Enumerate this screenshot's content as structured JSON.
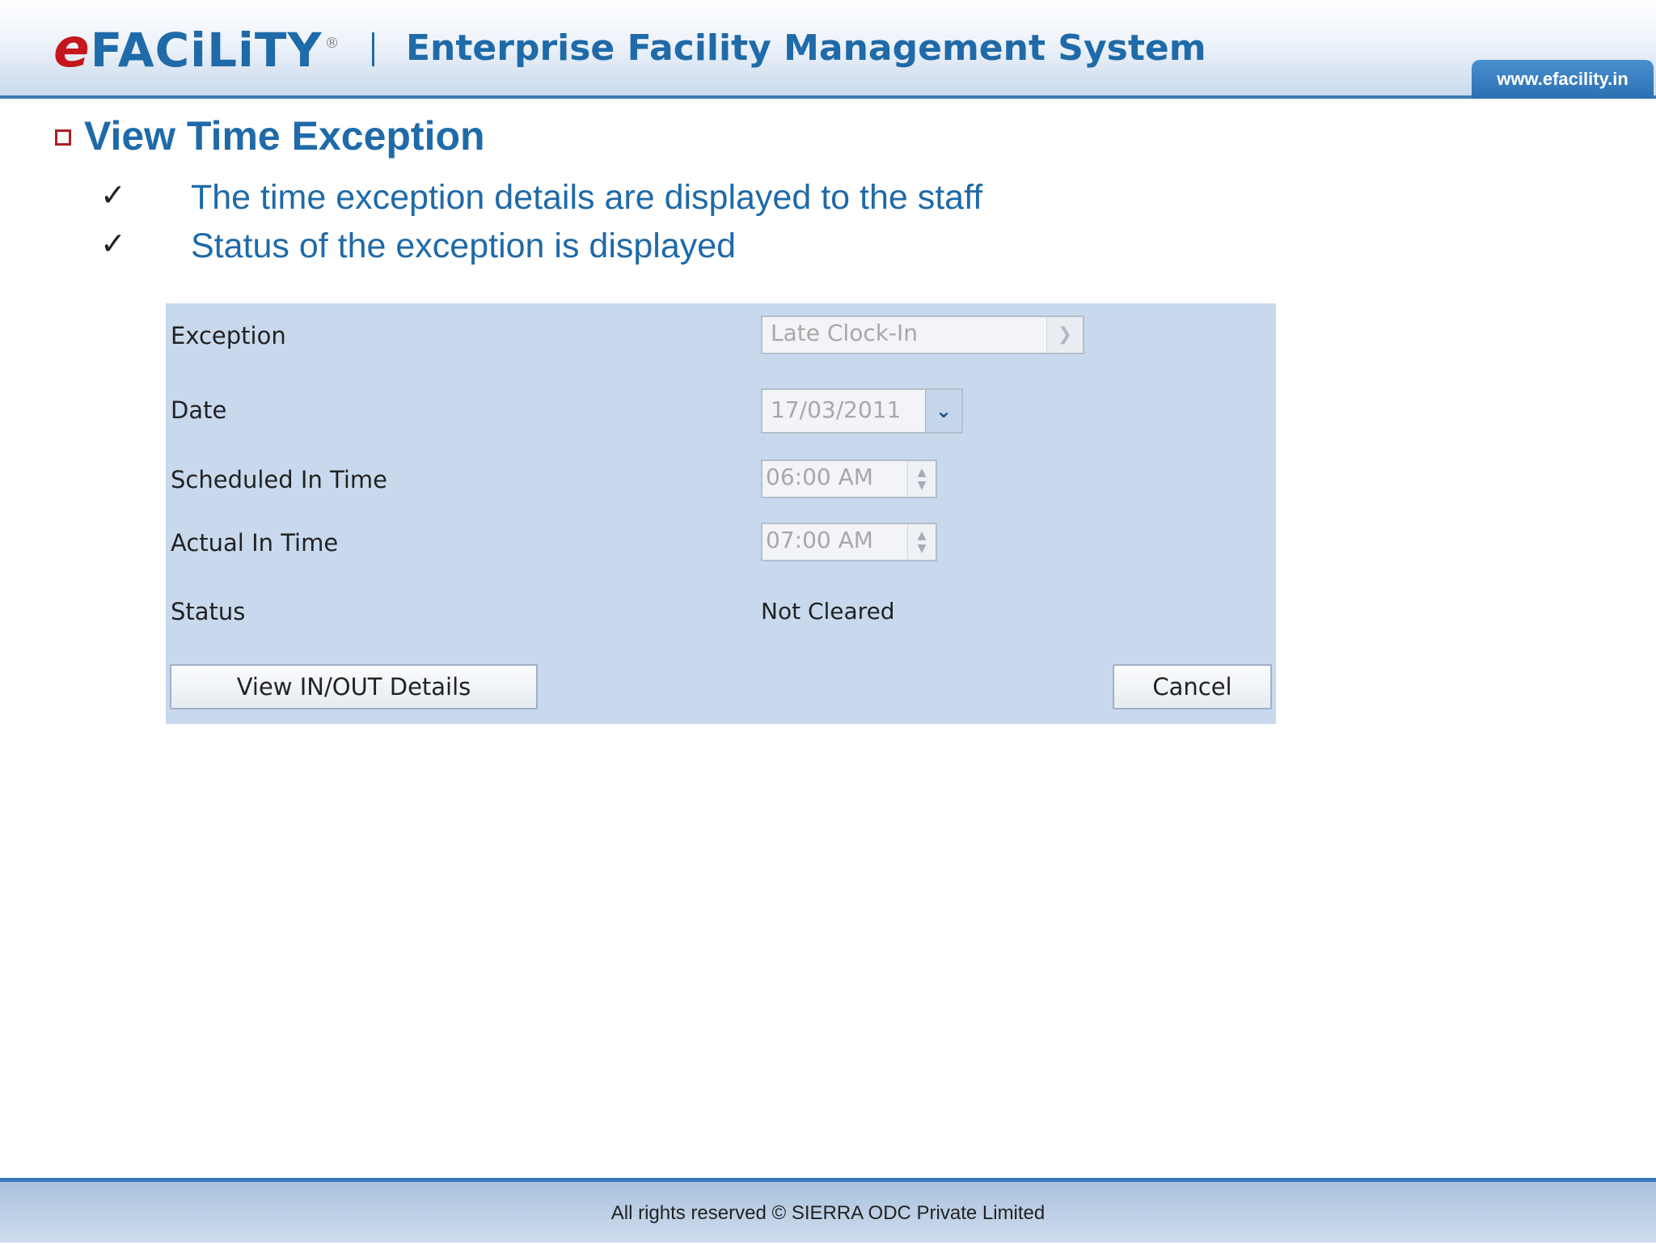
{
  "header": {
    "logo_prefix": "e",
    "logo_text": "FACiLiTY",
    "logo_registered": "®",
    "title": "Enterprise Facility Management System",
    "url": "www.efacility.in"
  },
  "section": {
    "title": "View Time Exception",
    "points": [
      "The time exception details are displayed to the staff",
      "Status of the exception is displayed"
    ],
    "check_glyph": "✓"
  },
  "form": {
    "exception": {
      "label": "Exception",
      "value": "Late Clock-In"
    },
    "date": {
      "label": "Date",
      "value": "17/03/2011"
    },
    "scheduled_in": {
      "label": "Scheduled In Time",
      "value": "06:00 AM"
    },
    "actual_in": {
      "label": "Actual In Time",
      "value": "07:00 AM"
    },
    "status": {
      "label": "Status",
      "value": "Not Cleared"
    },
    "view_button": "View IN/OUT Details",
    "cancel_button": "Cancel"
  },
  "footer": {
    "text": "All rights reserved © SIERRA ODC Private Limited"
  },
  "colors": {
    "brand_blue": "#1f6aa8",
    "logo_red": "#c4161c",
    "panel_bg": "#c8d9ee"
  },
  "icons": [
    "bullet-square-icon",
    "checkmark-icon",
    "chevron-down-icon",
    "spinner-arrows-icon"
  ]
}
